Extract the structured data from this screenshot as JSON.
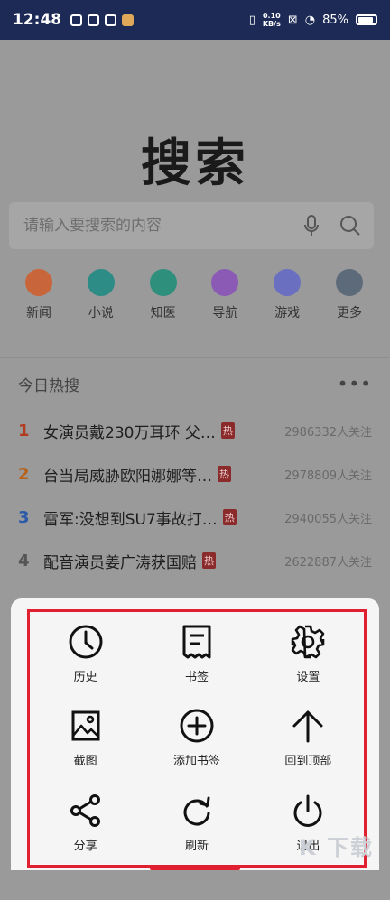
{
  "status_bar": {
    "time": "12:48",
    "net_speed_value": "0.10",
    "net_speed_unit": "KB/s",
    "battery": "85%"
  },
  "logo": "搜索",
  "search": {
    "placeholder": "请输入要搜索的内容"
  },
  "shortcuts": [
    {
      "label": "新闻",
      "color": "#c9653a"
    },
    {
      "label": "小说",
      "color": "#2d8c86"
    },
    {
      "label": "知医",
      "color": "#2e8f7d"
    },
    {
      "label": "导航",
      "color": "#8a5ab5"
    },
    {
      "label": "游戏",
      "color": "#6a6fc0"
    },
    {
      "label": "更多",
      "color": "#5d6a7a"
    }
  ],
  "hot": {
    "title": "今日热搜",
    "items": [
      {
        "rank": "1",
        "title": "女演员戴230万耳环 父…",
        "tag": "热",
        "count": "2986332人关注",
        "color": "#b23a1f"
      },
      {
        "rank": "2",
        "title": "台当局威胁欧阳娜娜等…",
        "tag": "热",
        "count": "2978809人关注",
        "color": "#b8621a"
      },
      {
        "rank": "3",
        "title": "雷军:没想到SU7事故打…",
        "tag": "热",
        "count": "2940055人关注",
        "color": "#2a5aa8"
      },
      {
        "rank": "4",
        "title": "配音演员姜广涛获国赔",
        "tag": "热",
        "count": "2622887人关注",
        "color": "#555555"
      }
    ]
  },
  "menu": {
    "items": [
      {
        "label": "历史",
        "icon": "clock-icon"
      },
      {
        "label": "书签",
        "icon": "bookmark-icon"
      },
      {
        "label": "设置",
        "icon": "gear-icon"
      },
      {
        "label": "截图",
        "icon": "image-icon"
      },
      {
        "label": "添加书签",
        "icon": "plus-circle-icon"
      },
      {
        "label": "回到顶部",
        "icon": "arrow-up-icon"
      },
      {
        "label": "分享",
        "icon": "share-icon"
      },
      {
        "label": "刷新",
        "icon": "refresh-icon"
      },
      {
        "label": "退出",
        "icon": "power-icon"
      }
    ]
  },
  "watermark": "K 下载"
}
